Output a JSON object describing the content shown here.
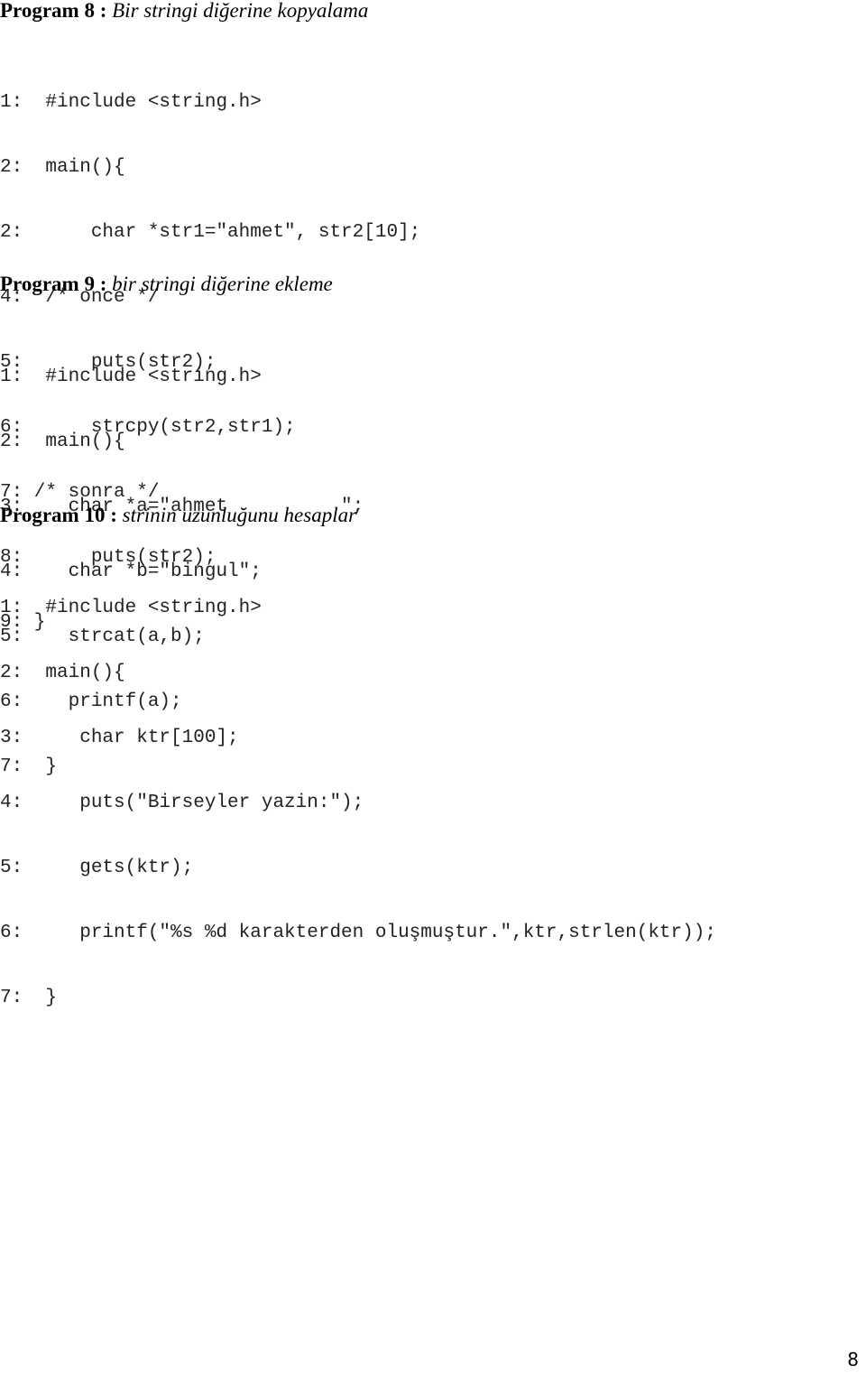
{
  "programs": [
    {
      "title": "Program 8 :",
      "description": "Bir stringi diğerine kopyalama",
      "lines": [
        "1:  #include <string.h>",
        "2:  main(){",
        "2:      char *str1=\"ahmet\", str2[10];",
        "4:  /* once */",
        "5:      puts(str2);",
        "6:      strcpy(str2,str1);",
        "7: /* sonra */",
        "8:      puts(str2);",
        "9: }"
      ]
    },
    {
      "title": "Program 9 :",
      "description": "bir stringi diğerine ekleme",
      "lines": [
        "1:  #include <string.h>",
        "2:  main(){",
        "3:    char *a=\"ahmet          \";",
        "4:    char *b=\"bingul\";",
        "5:    strcat(a,b);",
        "6:    printf(a);",
        "7:  }"
      ]
    },
    {
      "title": "Program 10 :",
      "description": "strinin uzunluğunu hesaplar",
      "lines": [
        "1:  #include <string.h>",
        "2:  main(){",
        "3:     char ktr[100];",
        "4:     puts(\"Birseyler yazin:\");",
        "5:     gets(ktr);",
        "6:     printf(\"%s %d karakterden oluşmuştur.\",ktr,strlen(ktr));",
        "7:  }"
      ]
    }
  ],
  "page_number": "8"
}
